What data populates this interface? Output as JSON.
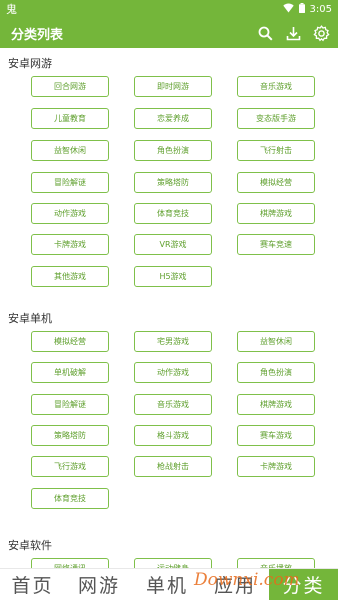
{
  "status": {
    "left_glyph": "鬼",
    "time": "3:05"
  },
  "app_bar": {
    "title": "分类列表",
    "icons": [
      "search-icon",
      "download-icon",
      "settings-icon"
    ]
  },
  "sections": [
    {
      "title": "安卓网游",
      "tags": [
        "回合网游",
        "即时网游",
        "音乐游戏",
        "儿童教育",
        "恋爱养成",
        "变态版手游",
        "益智休闲",
        "角色扮演",
        "飞行射击",
        "冒险解谜",
        "策略塔防",
        "模拟经营",
        "动作游戏",
        "体育竞技",
        "棋牌游戏",
        "卡牌游戏",
        "VR游戏",
        "赛车竞速",
        "其他游戏",
        "H5游戏"
      ]
    },
    {
      "title": "安卓单机",
      "tags": [
        "模拟经营",
        "宅男游戏",
        "益智休闲",
        "单机破解",
        "动作游戏",
        "角色扮演",
        "冒险解谜",
        "音乐游戏",
        "棋牌游戏",
        "策略塔防",
        "格斗游戏",
        "赛车游戏",
        "飞行游戏",
        "枪战射击",
        "卡牌游戏",
        "体育竞技"
      ]
    },
    {
      "title": "安卓软件",
      "tags": [
        "网络通讯",
        "运动健身",
        "音乐播放"
      ]
    }
  ],
  "bottom_nav": {
    "items": [
      "首页",
      "网游",
      "单机",
      "应用",
      "分类"
    ],
    "active_index": 4
  },
  "watermark": "Downxi.com",
  "colors": {
    "primary": "#74b63a",
    "tag_border": "#7fc04a",
    "tag_text": "#5e9f2c",
    "watermark": "#e86a1a"
  }
}
